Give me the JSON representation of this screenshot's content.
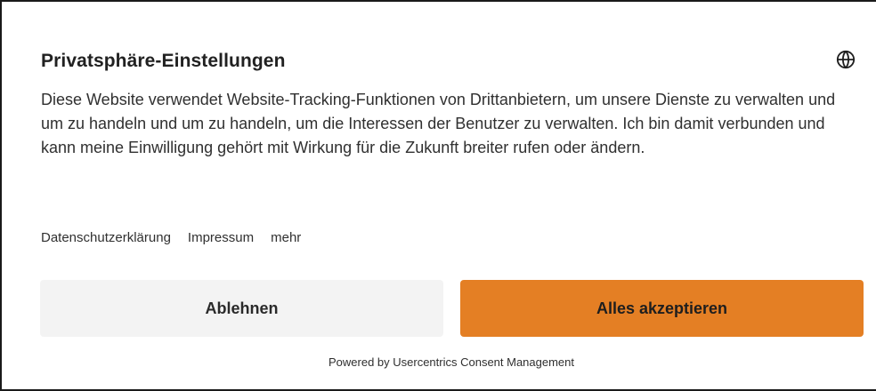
{
  "dialog": {
    "title": "Privatsphäre-Einstellungen",
    "language_icon": "globe-icon",
    "description": "Diese Website verwendet Website-Tracking-Funktionen von Drittanbietern, um unsere Dienste zu verwalten und um zu handeln und um zu handeln, um die Interessen der Benutzer zu verwalten. Ich bin damit verbunden und kann meine Einwilligung gehört mit Wirkung für die Zukunft breiter rufen oder ändern.",
    "links": {
      "privacy": "Datenschutzerklärung",
      "imprint": "Impressum",
      "more": "mehr"
    },
    "buttons": {
      "deny": "Ablehnen",
      "accept": "Alles akzeptieren"
    },
    "footer": "Powered by Usercentrics Consent Management"
  },
  "colors": {
    "accent": "#e47f24",
    "deny_background": "#f3f3f3",
    "border": "#1a1a1a"
  }
}
